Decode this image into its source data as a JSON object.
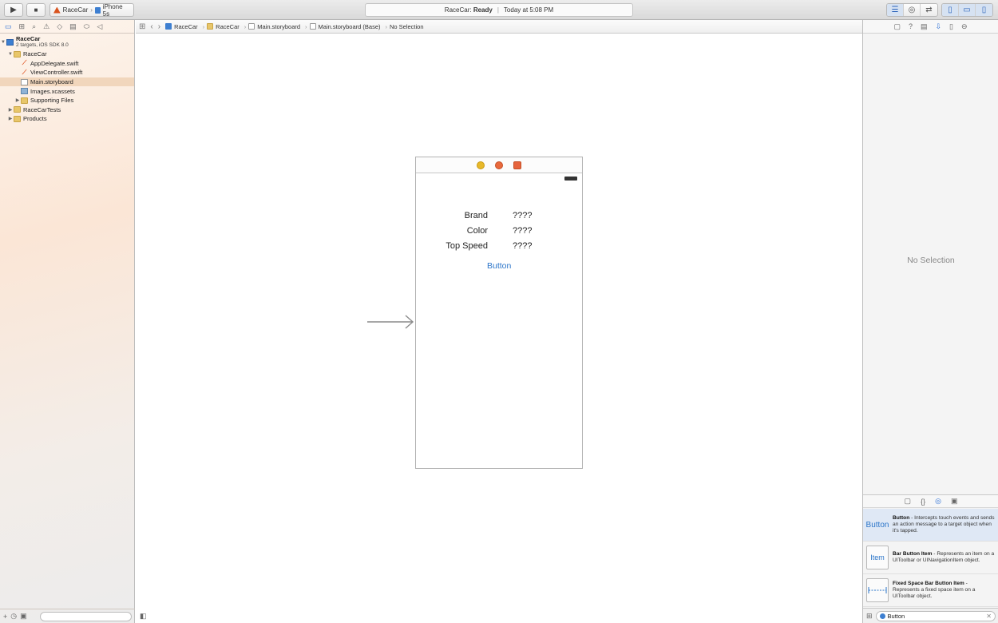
{
  "toolbar": {
    "run_icon": "▶",
    "stop_icon": "■",
    "scheme": "RaceCar",
    "scheme_sep": "›",
    "device": "iPhone 5s",
    "status_project": "RaceCar:",
    "status_state": "Ready",
    "status_sep": "|",
    "status_time": "Today at 5:08 PM"
  },
  "navigator": {
    "project_name": "RaceCar",
    "project_sub": "2 targets, iOS SDK 8.0",
    "items": [
      {
        "label": "RaceCar",
        "kind": "folder",
        "indent": 1,
        "disclosure": "▼"
      },
      {
        "label": "AppDelegate.swift",
        "kind": "swift",
        "indent": 2,
        "disclosure": ""
      },
      {
        "label": "ViewController.swift",
        "kind": "swift",
        "indent": 2,
        "disclosure": ""
      },
      {
        "label": "Main.storyboard",
        "kind": "file",
        "indent": 2,
        "disclosure": "",
        "selected": true
      },
      {
        "label": "Images.xcassets",
        "kind": "assets",
        "indent": 2,
        "disclosure": ""
      },
      {
        "label": "Supporting Files",
        "kind": "folder",
        "indent": 2,
        "disclosure": "▶"
      },
      {
        "label": "RaceCarTests",
        "kind": "folder",
        "indent": 1,
        "disclosure": "▶"
      },
      {
        "label": "Products",
        "kind": "folder",
        "indent": 1,
        "disclosure": "▶"
      }
    ]
  },
  "jumpbar": {
    "crumbs": [
      "RaceCar",
      "RaceCar",
      "Main.storyboard",
      "Main.storyboard (Base)",
      "No Selection"
    ]
  },
  "scene": {
    "rows": [
      {
        "label": "Brand",
        "value": "????"
      },
      {
        "label": "Color",
        "value": "????"
      },
      {
        "label": "Top Speed",
        "value": "????"
      }
    ],
    "button_title": "Button"
  },
  "inspector": {
    "no_selection": "No Selection"
  },
  "library": {
    "items": [
      {
        "thumb": "Button",
        "title": "Button",
        "desc": " - Intercepts touch events and sends an action message to a target object when it's tapped."
      },
      {
        "thumb": "Item",
        "title": "Bar Button Item",
        "desc": " - Represents an item on a UIToolbar or UINavigationItem object."
      },
      {
        "thumb": "",
        "title": "Fixed Space Bar Button Item",
        "desc": " - Represents a fixed space item on a UIToolbar object."
      }
    ],
    "filter_value": "Button"
  }
}
